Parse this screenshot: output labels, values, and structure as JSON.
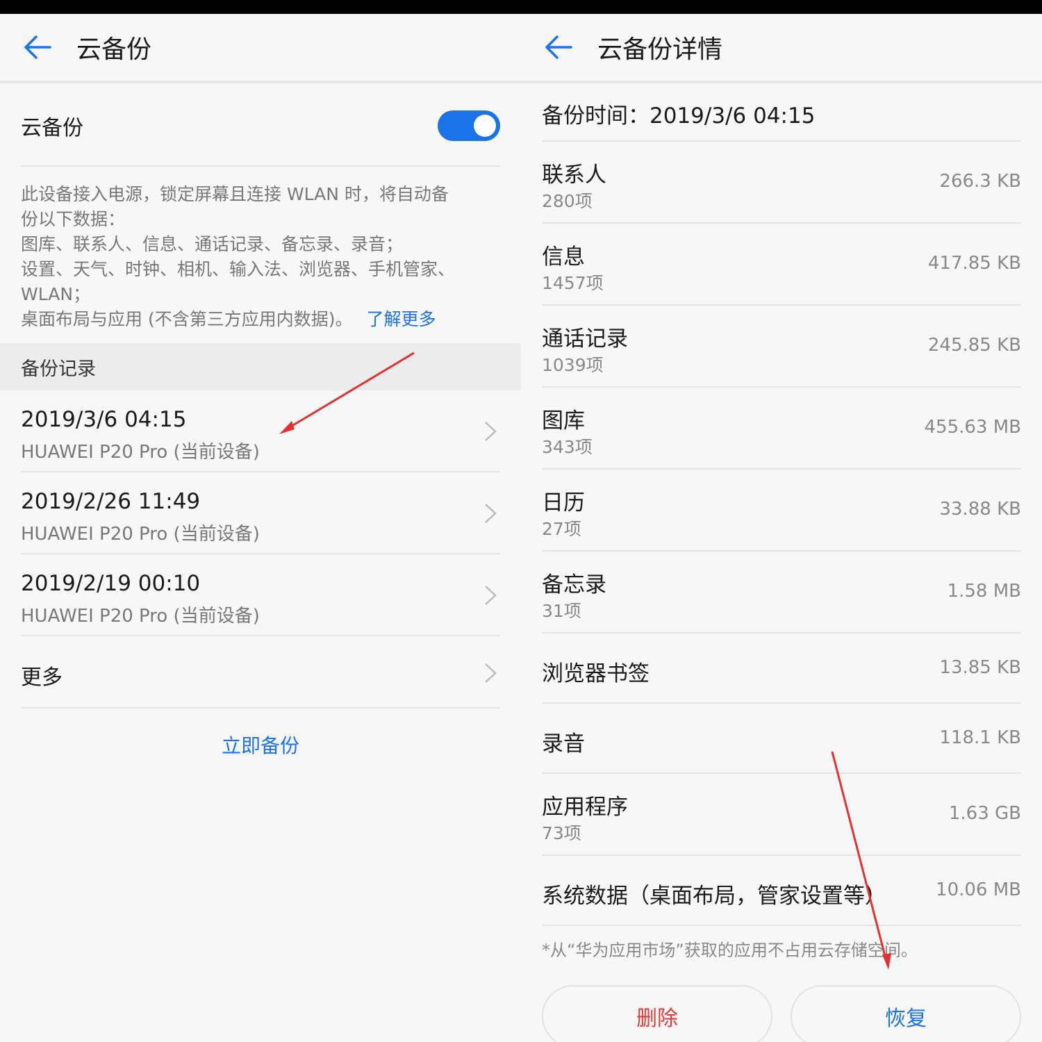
{
  "colors": {
    "accent": "#1a73e8",
    "danger": "#e53935",
    "annotation": "#e53030"
  },
  "left": {
    "title": "云备份",
    "toggle": {
      "label": "云备份",
      "on": true
    },
    "description": [
      "此设备接入电源，锁定屏幕且连接 WLAN 时，将自动备",
      "份以下数据：",
      "图库、联系人、信息、通话记录、备忘录、录音；",
      "设置、天气、时钟、相机、输入法、浏览器、手机管家、",
      "WLAN；",
      "桌面布局与应用 (不含第三方应用内数据)。"
    ],
    "learn_more": "了解更多",
    "section_title": "备份记录",
    "records": [
      {
        "date": "2019/3/6 04:15",
        "device": "HUAWEI P20 Pro (当前设备)"
      },
      {
        "date": "2019/2/26 11:49",
        "device": "HUAWEI P20 Pro (当前设备)"
      },
      {
        "date": "2019/2/19 00:10",
        "device": "HUAWEI P20 Pro (当前设备)"
      }
    ],
    "more": "更多",
    "backup_now": "立即备份"
  },
  "right": {
    "title": "云备份详情",
    "backup_time": "备份时间：2019/3/6 04:15",
    "items": [
      {
        "name": "联系人",
        "count": "280项",
        "size": "266.3 KB"
      },
      {
        "name": "信息",
        "count": "1457项",
        "size": "417.85 KB"
      },
      {
        "name": "通话记录",
        "count": "1039项",
        "size": "245.85 KB"
      },
      {
        "name": "图库",
        "count": "343项",
        "size": "455.63 MB"
      },
      {
        "name": "日历",
        "count": "27项",
        "size": "33.88 KB"
      },
      {
        "name": "备忘录",
        "count": "31项",
        "size": "1.58 MB"
      },
      {
        "name": "浏览器书签",
        "count": "",
        "size": "13.85 KB"
      },
      {
        "name": "录音",
        "count": "",
        "size": "118.1 KB"
      },
      {
        "name": "应用程序",
        "count": "73项",
        "size": "1.63 GB"
      },
      {
        "name": "系统数据（桌面布局，管家设置等）",
        "count": "",
        "size": "10.06 MB"
      }
    ],
    "footnote": "*从“华为应用市场”获取的应用不占用云存储空间。",
    "delete": "删除",
    "restore": "恢复"
  }
}
